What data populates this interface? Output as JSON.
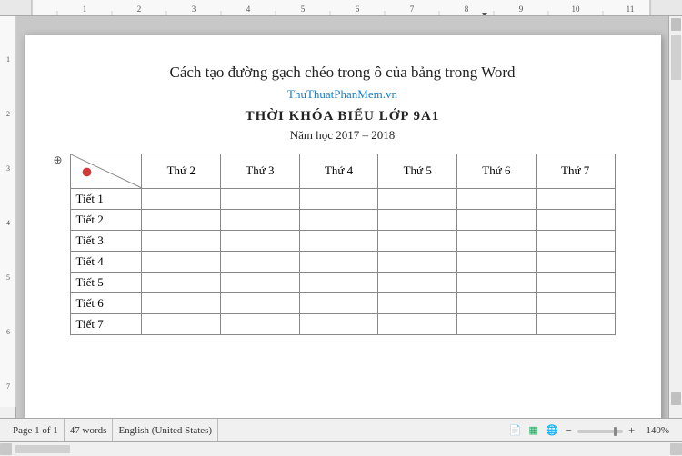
{
  "ruler": {
    "marks": [
      "1",
      "2",
      "3",
      "4",
      "5",
      "6",
      "7",
      "8",
      "9",
      "10",
      "11"
    ]
  },
  "page": {
    "title": "Cách tạo đường gạch chéo trong ô của bảng trong Word",
    "subtitle_link": "ThuThuatPhanMem.vn",
    "schedule_title": "THỜI KHÓA BIỂU LỚP 9A1",
    "school_year": "Năm học 2017 – 2018"
  },
  "table": {
    "headers": [
      "",
      "Thứ 2",
      "Thứ 3",
      "Thứ 4",
      "Thứ 5",
      "Thứ 6",
      "Thứ 7"
    ],
    "rows": [
      {
        "label": "Tiết 1",
        "cells": [
          "",
          "",
          "",
          "",
          "",
          ""
        ]
      },
      {
        "label": "Tiết 2",
        "cells": [
          "",
          "",
          "",
          "",
          "",
          ""
        ]
      },
      {
        "label": "Tiết 3",
        "cells": [
          "",
          "",
          "",
          "",
          "",
          ""
        ]
      },
      {
        "label": "Tiết 4",
        "cells": [
          "",
          "",
          "",
          "",
          "",
          ""
        ]
      },
      {
        "label": "Tiết 5",
        "cells": [
          "",
          "",
          "",
          "",
          "",
          ""
        ]
      },
      {
        "label": "Tiết 6",
        "cells": [
          "",
          "",
          "",
          "",
          "",
          ""
        ]
      },
      {
        "label": "Tiết 7",
        "cells": [
          "",
          "",
          "",
          "",
          "",
          ""
        ]
      }
    ]
  },
  "status_bar": {
    "page_info": "Page 1 of 1",
    "words": "47 words",
    "language": "English (United States)",
    "zoom": "140%"
  }
}
